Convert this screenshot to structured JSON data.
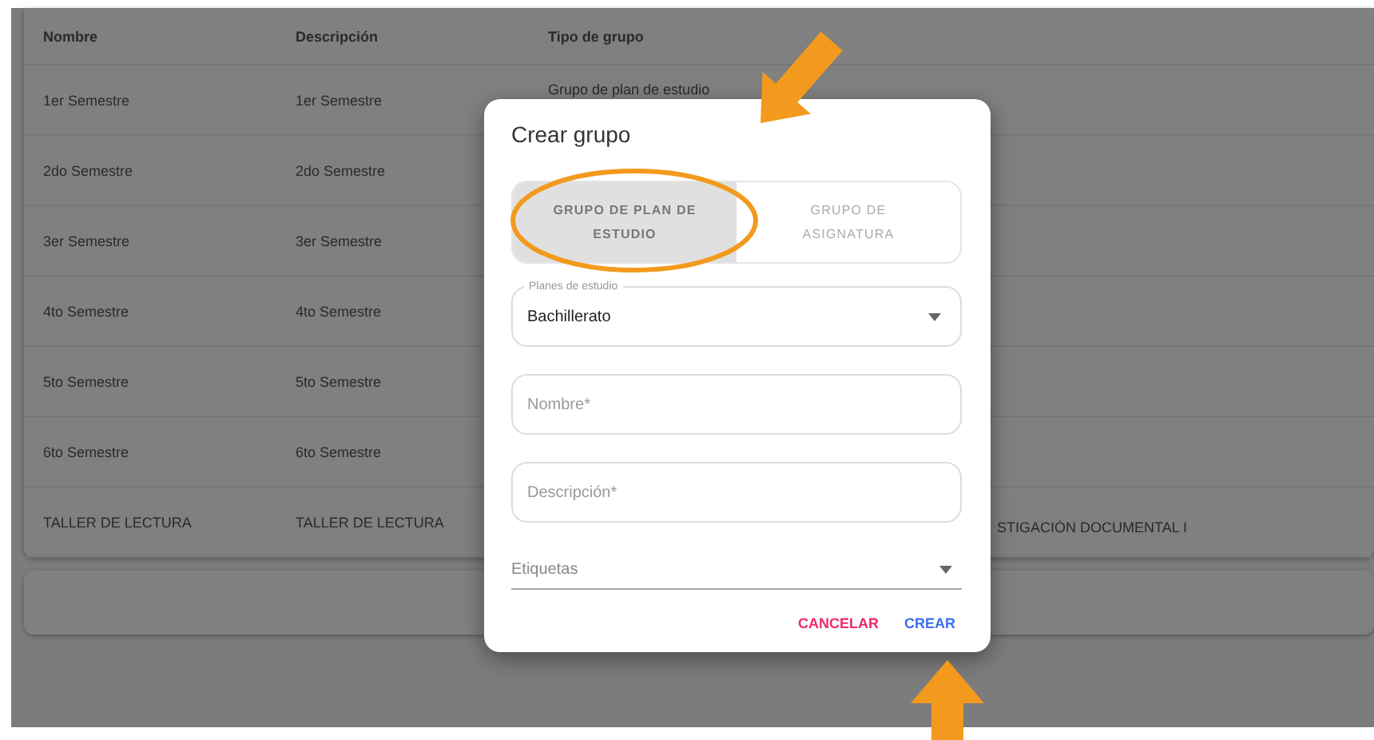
{
  "table": {
    "columns": [
      "Nombre",
      "Descripción",
      "Tipo de grupo"
    ],
    "rows": [
      {
        "nombre": "1er Semestre",
        "descripcion": "1er Semestre",
        "tipo": "Grupo de plan de estudio"
      },
      {
        "nombre": "2do Semestre",
        "descripcion": "2do Semestre"
      },
      {
        "nombre": "3er Semestre",
        "descripcion": "3er Semestre"
      },
      {
        "nombre": "4to Semestre",
        "descripcion": "4to Semestre"
      },
      {
        "nombre": "5to Semestre",
        "descripcion": "5to Semestre"
      },
      {
        "nombre": "6to Semestre",
        "descripcion": "6to Semestre"
      },
      {
        "nombre": "TALLER DE LECTURA",
        "descripcion": "TALLER DE LECTURA",
        "column_4": "STIGACIÓN DOCUMENTAL I"
      }
    ]
  },
  "dialog": {
    "title": "Crear grupo",
    "toggle": [
      {
        "label": "GRUPO DE PLAN DE ESTUDIO",
        "selected": true
      },
      {
        "label": "GRUPO DE ASIGNATURA",
        "selected": false
      }
    ],
    "fields": [
      {
        "kind": "select",
        "label": "Planes de estudio",
        "value": "Bachillerato"
      },
      {
        "kind": "text",
        "placeholder": "Nombre*"
      },
      {
        "kind": "text",
        "placeholder": "Descripción*"
      },
      {
        "kind": "underline-select",
        "placeholder": "Etiquetas"
      }
    ],
    "buttons": [
      {
        "label": "CANCELAR",
        "kind": "secondary"
      },
      {
        "label": "CREAR",
        "kind": "primary"
      }
    ]
  }
}
